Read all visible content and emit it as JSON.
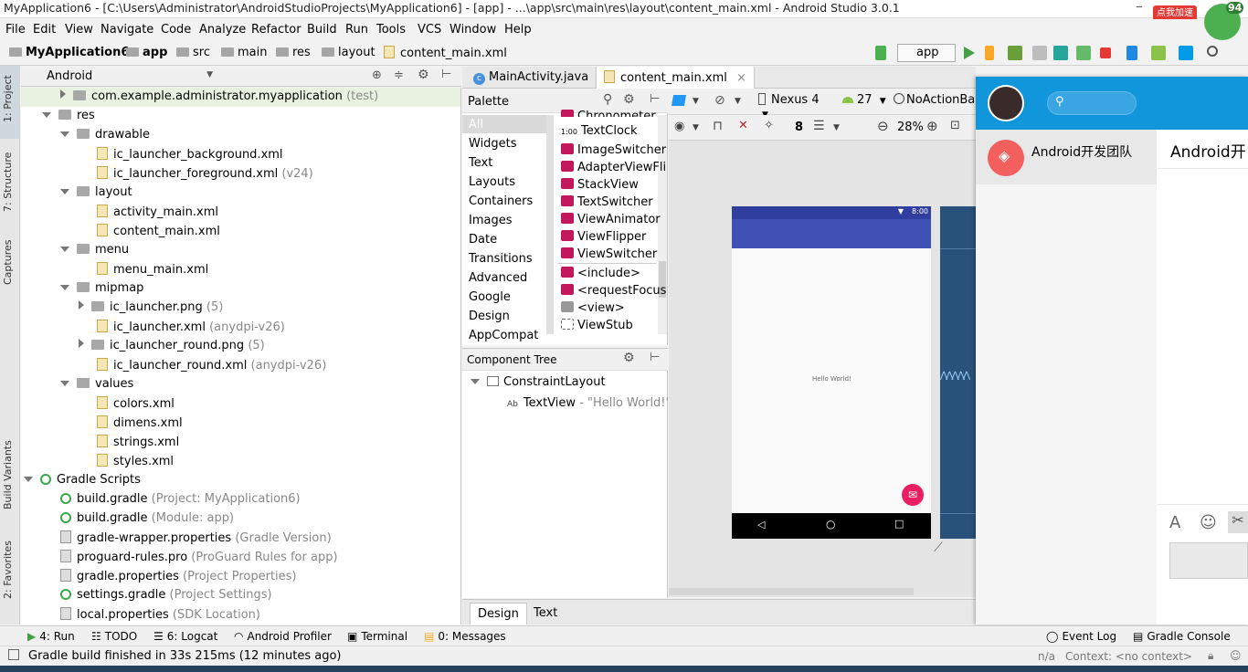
{
  "window": {
    "title": "MyApplication6 - [C:\\Users\\Administrator\\AndroidStudioProjects\\MyApplication6] - [app] - ...\\app\\src\\main\\res\\layout\\content_main.xml - Android Studio 3.0.1",
    "badge_text": "点我加速",
    "badge_count": "94"
  },
  "menu": [
    "File",
    "Edit",
    "View",
    "Navigate",
    "Code",
    "Analyze",
    "Refactor",
    "Build",
    "Run",
    "Tools",
    "VCS",
    "Window",
    "Help"
  ],
  "breadcrumb": [
    "MyApplication6",
    "app",
    "src",
    "main",
    "res",
    "layout",
    "content_main.xml"
  ],
  "run_config": "app",
  "left_strip": {
    "project": "1: Project",
    "structure": "7: Structure",
    "captures": "Captures",
    "build_variants": "Build Variants",
    "favorites": "2: Favorites"
  },
  "project_panel": {
    "view_mode": "Android",
    "rows": [
      {
        "label": "com.example.administrator.myapplication",
        "sub": "(test)"
      },
      {
        "label": "res",
        "sub": ""
      },
      {
        "label": "drawable",
        "sub": ""
      },
      {
        "label": "ic_launcher_background.xml",
        "sub": ""
      },
      {
        "label": "ic_launcher_foreground.xml",
        "sub": "(v24)"
      },
      {
        "label": "layout",
        "sub": ""
      },
      {
        "label": "activity_main.xml",
        "sub": ""
      },
      {
        "label": "content_main.xml",
        "sub": ""
      },
      {
        "label": "menu",
        "sub": ""
      },
      {
        "label": "menu_main.xml",
        "sub": ""
      },
      {
        "label": "mipmap",
        "sub": ""
      },
      {
        "label": "ic_launcher.png",
        "sub": "(5)"
      },
      {
        "label": "ic_launcher.xml",
        "sub": "(anydpi-v26)"
      },
      {
        "label": "ic_launcher_round.png",
        "sub": "(5)"
      },
      {
        "label": "ic_launcher_round.xml",
        "sub": "(anydpi-v26)"
      },
      {
        "label": "values",
        "sub": ""
      },
      {
        "label": "colors.xml",
        "sub": ""
      },
      {
        "label": "dimens.xml",
        "sub": ""
      },
      {
        "label": "strings.xml",
        "sub": ""
      },
      {
        "label": "styles.xml",
        "sub": ""
      },
      {
        "label": "Gradle Scripts",
        "sub": ""
      },
      {
        "label": "build.gradle",
        "sub": "(Project: MyApplication6)"
      },
      {
        "label": "build.gradle",
        "sub": "(Module: app)"
      },
      {
        "label": "gradle-wrapper.properties",
        "sub": "(Gradle Version)"
      },
      {
        "label": "proguard-rules.pro",
        "sub": "(ProGuard Rules for app)"
      },
      {
        "label": "gradle.properties",
        "sub": "(Project Properties)"
      },
      {
        "label": "settings.gradle",
        "sub": "(Project Settings)"
      },
      {
        "label": "local.properties",
        "sub": "(SDK Location)"
      }
    ]
  },
  "editor_tabs": [
    "MainActivity.java",
    "content_main.xml"
  ],
  "palette": {
    "title": "Palette",
    "categories": [
      "All",
      "Widgets",
      "Text",
      "Layouts",
      "Containers",
      "Images",
      "Date",
      "Transitions",
      "Advanced",
      "Google",
      "Design",
      "AppCompat"
    ],
    "items": [
      "Chronometer",
      "TextClock",
      "ImageSwitcher",
      "AdapterViewFli",
      "StackView",
      "TextSwitcher",
      "ViewAnimator",
      "ViewFlipper",
      "ViewSwitcher",
      "<include>",
      "<requestFocus",
      "<view>",
      "ViewStub"
    ],
    "textclock_prefix": "1:00"
  },
  "component_tree": {
    "title": "Component Tree",
    "root": "ConstraintLayout",
    "child": "TextView",
    "child_value": "- \"Hello World!\""
  },
  "design_toolbar": {
    "device": "Nexus 4",
    "api": "27",
    "theme": "NoActionBar",
    "margin": "8",
    "zoom": "28%"
  },
  "phone": {
    "status_time": "8:00",
    "hello": "Hello World!"
  },
  "bottom_tabs": [
    "Design",
    "Text"
  ],
  "chat": {
    "contact": "Android开发团队",
    "header_title": "Android开"
  },
  "tool_windows": {
    "run": "4: Run",
    "todo": "TODO",
    "logcat": "6: Logcat",
    "profiler": "Android Profiler",
    "terminal": "Terminal",
    "messages": "0: Messages",
    "event_log": "Event Log",
    "gradle_console": "Gradle Console"
  },
  "status": {
    "message": "Gradle build finished in 33s 215ms (12 minutes ago)",
    "na": "n/a",
    "context": "Context: <no context>"
  },
  "colors": {
    "accent": "#3f51b5",
    "chat_blue": "#1296db",
    "fab": "#e91e63"
  }
}
